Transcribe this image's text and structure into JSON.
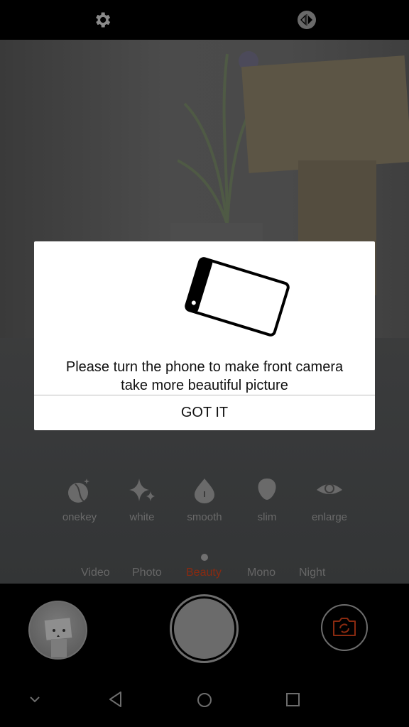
{
  "top_bar": {
    "settings_icon": "gear-icon",
    "mirror_icon": "mirror-flip-icon"
  },
  "dialog": {
    "illustration": "rotated-phone-icon",
    "message_line1": "Please turn the phone to make front camera",
    "message_line2": "take more beautiful picture",
    "confirm_label": "GOT IT"
  },
  "beauty_options": [
    {
      "label": "onekey",
      "icon": "face-sparkle-icon"
    },
    {
      "label": "white",
      "icon": "sparkle-icon"
    },
    {
      "label": "smooth",
      "icon": "drop-icon"
    },
    {
      "label": "slim",
      "icon": "face-slim-icon"
    },
    {
      "label": "enlarge",
      "icon": "eye-icon"
    }
  ],
  "modes": [
    {
      "label": "Video",
      "active": false
    },
    {
      "label": "Photo",
      "active": false
    },
    {
      "label": "Beauty",
      "active": true
    },
    {
      "label": "Mono",
      "active": false
    },
    {
      "label": "Night",
      "active": false
    }
  ],
  "colors": {
    "accent": "#8a2a10",
    "dialog_bg": "#ffffff",
    "inactive_text": "#666666"
  },
  "controls": {
    "gallery_icon": "gallery-thumbnail",
    "shutter_icon": "shutter-button",
    "switch_icon": "camera-switch-icon"
  },
  "nav_bar": {
    "icons": [
      "chevron-down-icon",
      "back-icon",
      "home-icon",
      "recents-icon"
    ]
  }
}
